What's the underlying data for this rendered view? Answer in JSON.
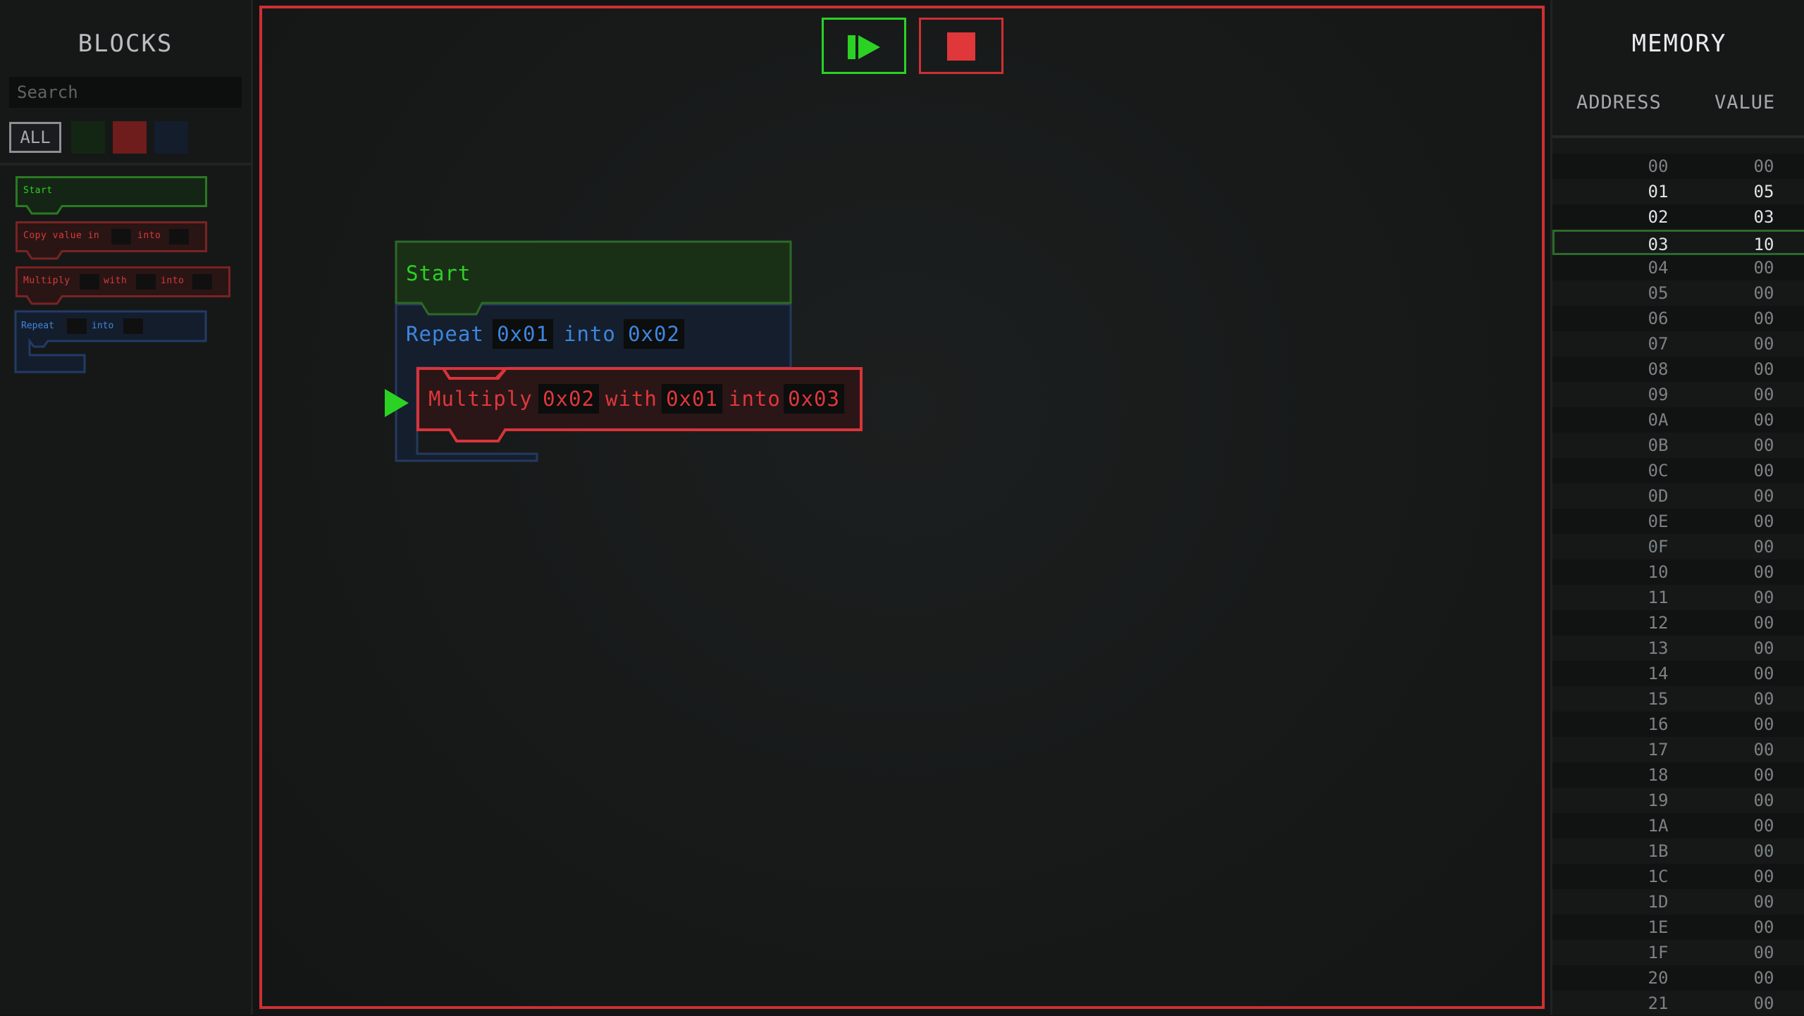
{
  "sidebar": {
    "title": "BLOCKS",
    "search_placeholder": "Search",
    "filters": {
      "all_label": "ALL",
      "swatches": [
        {
          "name": "green",
          "color": "#132613"
        },
        {
          "name": "red",
          "color": "#6e1c1c"
        },
        {
          "name": "blue",
          "color": "#141d2c"
        }
      ]
    },
    "palette": {
      "start": {
        "label": "Start"
      },
      "copy": {
        "label": "Copy value in",
        "into": "into"
      },
      "multiply": {
        "label": "Multiply",
        "with": "with",
        "into": "into"
      },
      "repeat": {
        "label": "Repeat",
        "into": "into"
      }
    }
  },
  "toolbar": {
    "run_icon": "step-play-icon",
    "stop_icon": "stop-square-icon"
  },
  "program": {
    "start": {
      "label": "Start"
    },
    "repeat": {
      "label": "Repeat",
      "arg1": "0x01",
      "into": "into",
      "arg2": "0x02"
    },
    "multiply": {
      "label": "Multiply",
      "arg1": "0x02",
      "with": "with",
      "arg2": "0x01",
      "into": "into",
      "arg3": "0x03"
    },
    "current_line_indicator": "play-arrow-icon"
  },
  "memory": {
    "title": "MEMORY",
    "address_header": "ADDRESS",
    "value_header": "VALUE",
    "highlighted_address": "03",
    "rows": [
      {
        "address": "00",
        "value": "00"
      },
      {
        "address": "01",
        "value": "05"
      },
      {
        "address": "02",
        "value": "03"
      },
      {
        "address": "03",
        "value": "10"
      },
      {
        "address": "04",
        "value": "00"
      },
      {
        "address": "05",
        "value": "00"
      },
      {
        "address": "06",
        "value": "00"
      },
      {
        "address": "07",
        "value": "00"
      },
      {
        "address": "08",
        "value": "00"
      },
      {
        "address": "09",
        "value": "00"
      },
      {
        "address": "0A",
        "value": "00"
      },
      {
        "address": "0B",
        "value": "00"
      },
      {
        "address": "0C",
        "value": "00"
      },
      {
        "address": "0D",
        "value": "00"
      },
      {
        "address": "0E",
        "value": "00"
      },
      {
        "address": "0F",
        "value": "00"
      },
      {
        "address": "10",
        "value": "00"
      },
      {
        "address": "11",
        "value": "00"
      },
      {
        "address": "12",
        "value": "00"
      },
      {
        "address": "13",
        "value": "00"
      },
      {
        "address": "14",
        "value": "00"
      },
      {
        "address": "15",
        "value": "00"
      },
      {
        "address": "16",
        "value": "00"
      },
      {
        "address": "17",
        "value": "00"
      },
      {
        "address": "18",
        "value": "00"
      },
      {
        "address": "19",
        "value": "00"
      },
      {
        "address": "1A",
        "value": "00"
      },
      {
        "address": "1B",
        "value": "00"
      },
      {
        "address": "1C",
        "value": "00"
      },
      {
        "address": "1D",
        "value": "00"
      },
      {
        "address": "1E",
        "value": "00"
      },
      {
        "address": "1F",
        "value": "00"
      },
      {
        "address": "20",
        "value": "00"
      },
      {
        "address": "21",
        "value": "00"
      }
    ]
  },
  "colors": {
    "green": "#2bd224",
    "red": "#e0373a",
    "blue": "#3d86e0",
    "editor_border": "#cf2f33"
  }
}
